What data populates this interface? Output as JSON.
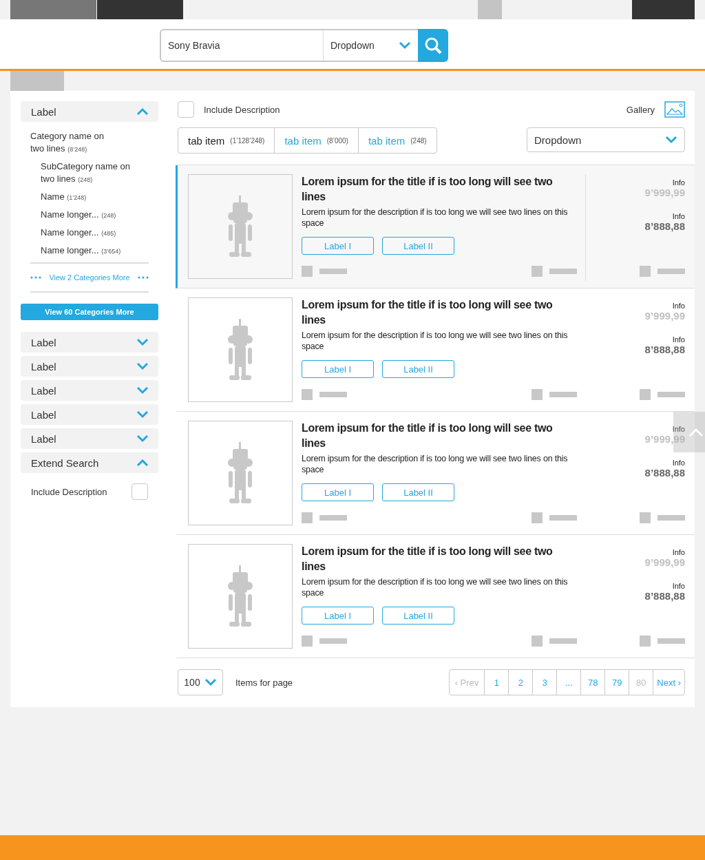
{
  "search": {
    "value": "Sony Bravia",
    "dropdown": "Dropdown"
  },
  "sidebar": {
    "sections": [
      {
        "label": "Label",
        "expanded": true,
        "categories": [
          {
            "name": "Category name on two lines",
            "count": "(8’248)",
            "children": [
              {
                "name": "SubCategory name on two lines",
                "count": "(248)"
              },
              {
                "name": "Name",
                "count": "(1’248)"
              },
              {
                "name": "Name longer...",
                "count": "(248)"
              },
              {
                "name": "Name longer...",
                "count": "(485)"
              },
              {
                "name": "Name longer...",
                "count": "(3’654)"
              }
            ]
          }
        ],
        "more_link": "View 2 Categories More"
      }
    ],
    "more_button": "View 60 Categories More",
    "filters": [
      {
        "label": "Label",
        "expanded": false
      },
      {
        "label": "Label",
        "expanded": false
      },
      {
        "label": "Label",
        "expanded": false
      },
      {
        "label": "Label",
        "expanded": false
      },
      {
        "label": "Label",
        "expanded": false
      },
      {
        "label": "Extend Search",
        "expanded": true,
        "option": {
          "label": "Include Description",
          "checked": false
        }
      }
    ]
  },
  "toolbar": {
    "include_description": {
      "label": "Include Description",
      "checked": false
    },
    "gallery": "Gallery"
  },
  "tabs": [
    {
      "label": "tab item",
      "count": "(1’128’248)",
      "selected": true
    },
    {
      "label": "tab item",
      "count": "(8’000)",
      "selected": false
    },
    {
      "label": "tab item",
      "count": "(248)",
      "selected": false
    }
  ],
  "sort_dropdown": "Dropdown",
  "products": [
    {
      "title": "Lorem ipsum for the title if is too long will see two lines",
      "description": "Lorem ipsum for the description if is too long we will see two lines on this space",
      "buttons": [
        "Label I",
        "Label II"
      ],
      "prices": [
        {
          "label": "Info",
          "value": "9’999,99",
          "kind": "old"
        },
        {
          "label": "Info",
          "value": "8’888,88",
          "kind": "current"
        }
      ],
      "selected": true
    },
    {
      "title": "Lorem ipsum for the title if is too long will see two lines",
      "description": "Lorem ipsum for the description if is too long we will see two lines on this space",
      "buttons": [
        "Label I",
        "Label II"
      ],
      "prices": [
        {
          "label": "Info",
          "value": "9’999,99",
          "kind": "old"
        },
        {
          "label": "Info",
          "value": "8’888,88",
          "kind": "current"
        }
      ],
      "selected": false
    },
    {
      "title": "Lorem ipsum for the title if is too long will see two lines",
      "description": "Lorem ipsum for the description if is too long we will see two lines on this space",
      "buttons": [
        "Label I",
        "Label II"
      ],
      "prices": [
        {
          "label": "Info",
          "value": "9’999,99",
          "kind": "old"
        },
        {
          "label": "Info",
          "value": "8’888,88",
          "kind": "current"
        }
      ],
      "selected": false
    },
    {
      "title": "Lorem ipsum for the title if is too long will see two lines",
      "description": "Lorem ipsum for the description if is too long we will see two lines on this space",
      "buttons": [
        "Label I",
        "Label II"
      ],
      "prices": [
        {
          "label": "Info",
          "value": "9’999,99",
          "kind": "old"
        },
        {
          "label": "Info",
          "value": "8’888,88",
          "kind": "current"
        }
      ],
      "selected": false
    }
  ],
  "pagination": {
    "per_page": "100",
    "per_page_label": "Items for page",
    "pages": [
      {
        "label": "‹ Prev",
        "disabled": true
      },
      {
        "label": "1",
        "disabled": false
      },
      {
        "label": "2",
        "disabled": false
      },
      {
        "label": "3",
        "disabled": false
      },
      {
        "label": "...",
        "disabled": false
      },
      {
        "label": "78",
        "disabled": false
      },
      {
        "label": "79",
        "disabled": false
      },
      {
        "label": "80",
        "disabled": true
      },
      {
        "label": "Next ›",
        "disabled": false
      }
    ]
  }
}
